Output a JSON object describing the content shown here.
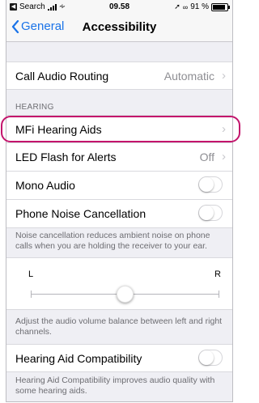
{
  "status_bar": {
    "back_app": "Search",
    "time": "09.58",
    "battery": "91 %",
    "battery_level": 0.91,
    "icons": [
      "signal-icon",
      "wifi-icon",
      "location-icon",
      "bluetooth-icon",
      "battery-icon"
    ]
  },
  "nav": {
    "back_label": "General",
    "title": "Accessibility"
  },
  "call_audio": {
    "label": "Call Audio Routing",
    "value": "Automatic"
  },
  "hearing_header": "HEARING",
  "mfi": {
    "label": "MFi Hearing Aids"
  },
  "led": {
    "label": "LED Flash for Alerts",
    "value": "Off"
  },
  "mono": {
    "label": "Mono Audio",
    "on": false
  },
  "noise": {
    "label": "Phone Noise Cancellation",
    "on": false
  },
  "noise_footer": "Noise cancellation reduces ambient noise on phone calls when you are holding the receiver to your ear.",
  "balance": {
    "left": "L",
    "right": "R",
    "position": 0.5
  },
  "balance_footer": "Adjust the audio volume balance between left and right channels.",
  "hac": {
    "label": "Hearing Aid Compatibility",
    "on": false
  },
  "hac_footer": "Hearing Aid Compatibility improves audio quality with some hearing aids.",
  "colors": {
    "accent": "#1a73e8",
    "highlight": "#c3146c",
    "background": "#efeff4"
  }
}
